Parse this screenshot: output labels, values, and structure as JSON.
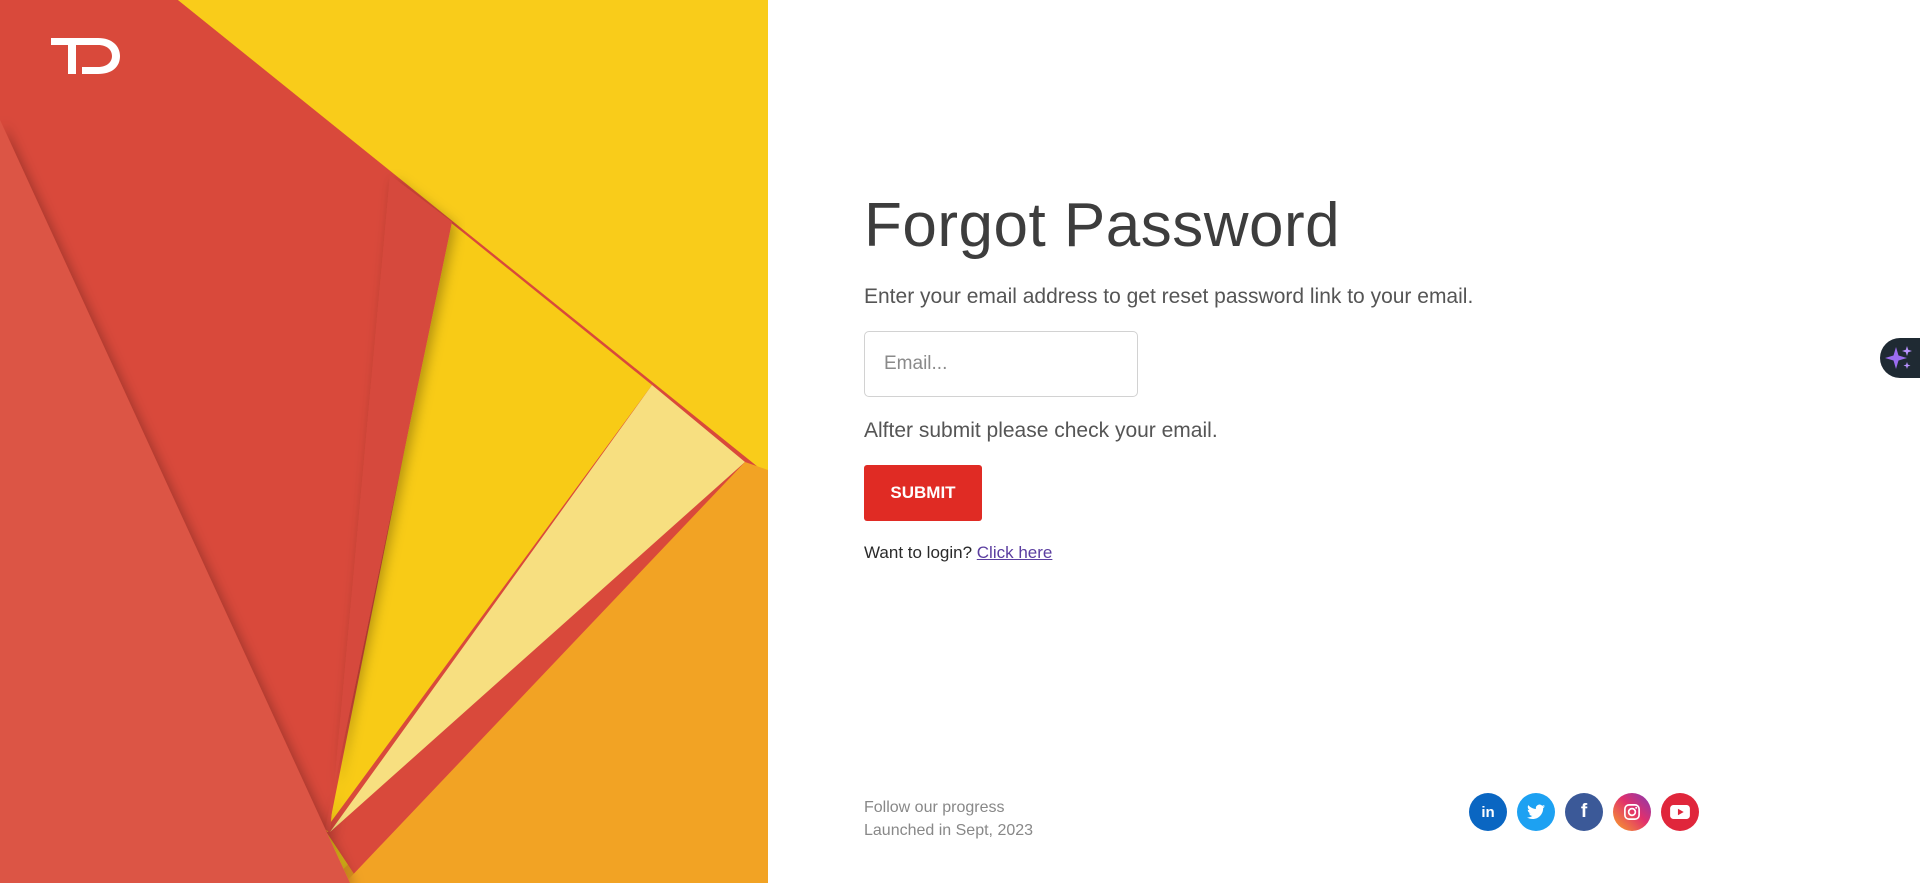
{
  "brand": {
    "logo_icon": "td-logo-icon",
    "logo_text": "TD"
  },
  "form": {
    "title": "Forgot Password",
    "subtitle": "Enter your email address to get reset password link to your email.",
    "email_placeholder": "Email...",
    "email_value": "",
    "note": "Alfter submit please check your email.",
    "submit_label": "SUBMIT",
    "login_prompt": "Want to login?",
    "login_link": "Click here"
  },
  "footer": {
    "line1": "Follow our progress",
    "line2": "Launched in Sept, 2023"
  },
  "socials": [
    {
      "name": "linkedin-icon",
      "glyph": "in",
      "color": "#0a66c2"
    },
    {
      "name": "twitter-icon",
      "glyph": "bird",
      "color": "#1da1f2"
    },
    {
      "name": "facebook-icon",
      "glyph": "f",
      "color": "#3b5998"
    },
    {
      "name": "instagram-icon",
      "glyph": "camera",
      "color": "#d62976"
    },
    {
      "name": "youtube-icon",
      "glyph": "play",
      "color": "#e0263b"
    }
  ],
  "assistant": {
    "icon": "sparkle-icon",
    "accent": "#9b6cf0"
  },
  "colors": {
    "red": "#e02b24",
    "art_red": "#d9483a",
    "art_yellow": "#f9cc1a",
    "art_orange": "#f2a324"
  }
}
